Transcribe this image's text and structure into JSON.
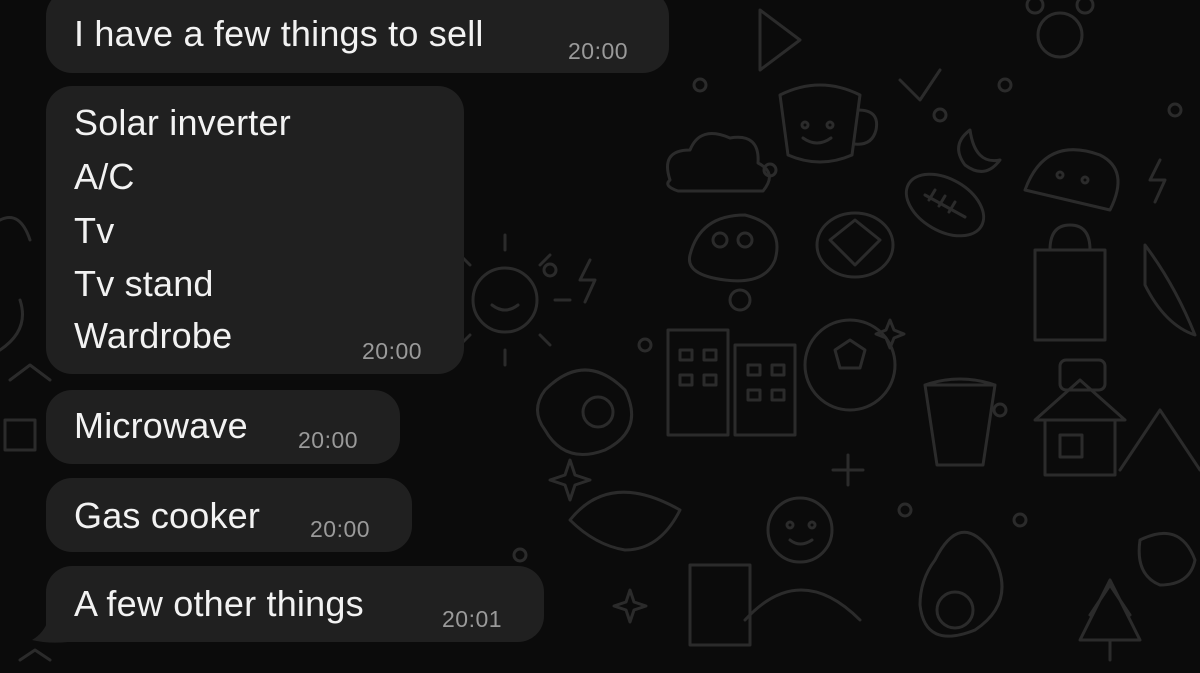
{
  "chat": {
    "messages": [
      {
        "lines": [
          "I have a few things to sell"
        ],
        "time": "20:00"
      },
      {
        "lines": [
          "Solar inverter",
          "A/C",
          "Tv",
          "Tv stand",
          "Wardrobe"
        ],
        "time": "20:00"
      },
      {
        "lines": [
          "Microwave"
        ],
        "time": "20:00"
      },
      {
        "lines": [
          "Gas cooker"
        ],
        "time": "20:00"
      },
      {
        "lines": [
          "A few other things"
        ],
        "time": "20:01"
      }
    ]
  },
  "colors": {
    "background": "#0b0b0b",
    "bubble": "#202020",
    "text": "#f2f2f2",
    "timestamp": "#9a9a9a",
    "doodle": "#2a2a2a"
  }
}
